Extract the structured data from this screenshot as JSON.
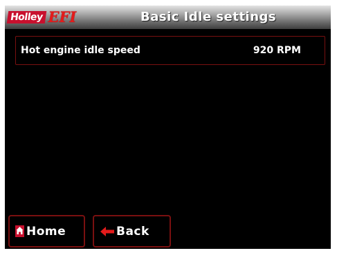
{
  "header": {
    "logo_brand": "Holley",
    "logo_efi": "EFI",
    "title": "Basic Idle settings"
  },
  "setting": {
    "label": "Hot engine idle speed",
    "value": "920 RPM"
  },
  "buttons": {
    "home_label": "Home",
    "back_label": "Back",
    "home_icon": "home-icon",
    "back_icon": "back-arrow-icon"
  },
  "colors": {
    "screen_background": "#000000",
    "accent_red": "#c8102e",
    "border_red": "#7a1010",
    "text": "#ffffff"
  }
}
